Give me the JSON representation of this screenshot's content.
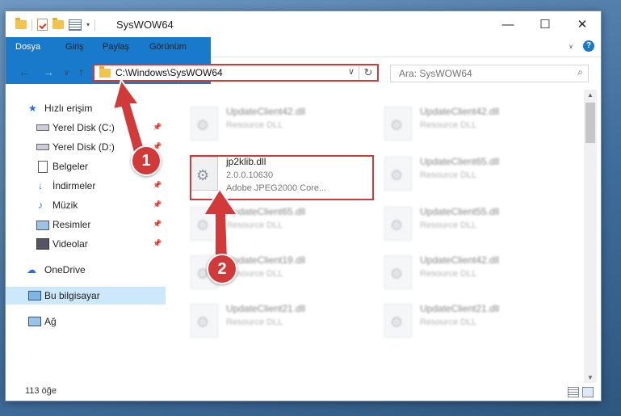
{
  "window": {
    "title": "SysWOW64"
  },
  "ribbon": {
    "tabs": [
      "Dosya",
      "Giriş",
      "Paylaş",
      "Görünüm"
    ]
  },
  "address": {
    "path": "C:\\Windows\\SysWOW64"
  },
  "search": {
    "placeholder": "Ara: SysWOW64"
  },
  "sidebar": {
    "quick_access": "Hızlı erişim",
    "items": [
      {
        "label": "Yerel Disk (C:)",
        "icon": "drive-icon",
        "pinned": true
      },
      {
        "label": "Yerel Disk (D:)",
        "icon": "drive-icon",
        "pinned": true
      },
      {
        "label": "Belgeler",
        "icon": "documents-icon",
        "pinned": true
      },
      {
        "label": "İndirmeler",
        "icon": "download-icon",
        "pinned": true
      },
      {
        "label": "Müzik",
        "icon": "music-icon",
        "pinned": true
      },
      {
        "label": "Resimler",
        "icon": "pictures-icon",
        "pinned": true
      },
      {
        "label": "Videolar",
        "icon": "videos-icon",
        "pinned": true
      }
    ],
    "onedrive": "OneDrive",
    "this_pc": "Bu bilgisayar",
    "network": "Ağ"
  },
  "files": {
    "highlighted": {
      "name": "jp2klib.dll",
      "version": "2.0.0.10630",
      "description": "Adobe JPEG2000 Core..."
    },
    "left_column": [
      {
        "name": "UpdateClient42.dll",
        "desc": "Resource DLL"
      },
      {
        "name": "UpdateClient65.dll",
        "desc": "Resource DLL"
      },
      {
        "name": "UpdateClient19.dll",
        "desc": "Resource DLL"
      },
      {
        "name": "UpdateClient21.dll",
        "desc": "Resource DLL"
      }
    ],
    "right_column": [
      {
        "name": "UpdateClient42.dll",
        "desc": "Resource DLL"
      },
      {
        "name": "UpdateClient65.dll",
        "desc": "Resource DLL"
      },
      {
        "name": "UpdateClient55.dll",
        "desc": "Resource DLL"
      },
      {
        "name": "UpdateClient42.dll",
        "desc": "Resource DLL"
      },
      {
        "name": "UpdateClient21.dll",
        "desc": "Resource DLL"
      }
    ]
  },
  "status": {
    "count": "113 öğe"
  },
  "annotations": {
    "step1": "1",
    "step2": "2"
  },
  "colors": {
    "accent": "#1979ca",
    "highlight": "#d23a3a",
    "selection": "#cde8fb"
  }
}
